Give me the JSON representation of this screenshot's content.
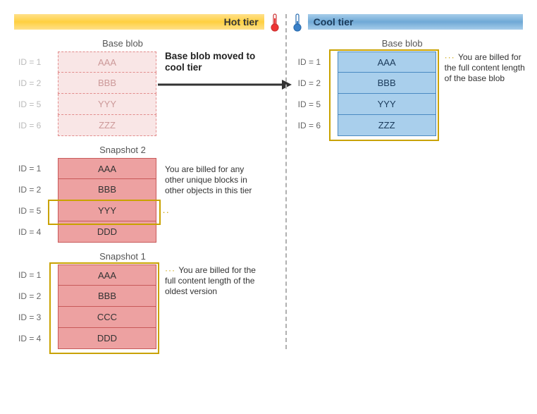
{
  "hot": {
    "label": "Hot tier",
    "base": {
      "title": "Base blob",
      "rows": [
        {
          "id": "ID = 1",
          "val": "AAA"
        },
        {
          "id": "ID = 2",
          "val": "BBB"
        },
        {
          "id": "ID = 5",
          "val": "YYY"
        },
        {
          "id": "ID = 6",
          "val": "ZZZ"
        }
      ]
    },
    "snap2": {
      "title": "Snapshot 2",
      "rows": [
        {
          "id": "ID = 1",
          "val": "AAA"
        },
        {
          "id": "ID = 2",
          "val": "BBB"
        },
        {
          "id": "ID = 5",
          "val": "YYY"
        },
        {
          "id": "ID = 4",
          "val": "DDD"
        }
      ],
      "note": "You are billed for any other unique blocks in other objects in this tier"
    },
    "snap1": {
      "title": "Snapshot 1",
      "rows": [
        {
          "id": "ID = 1",
          "val": "AAA"
        },
        {
          "id": "ID = 2",
          "val": "BBB"
        },
        {
          "id": "ID = 3",
          "val": "CCC"
        },
        {
          "id": "ID = 4",
          "val": "DDD"
        }
      ],
      "note": "You are billed for the full content length of the oldest version"
    },
    "arrow_label": "Base blob moved to cool tier"
  },
  "cool": {
    "label": "Cool tier",
    "base": {
      "title": "Base blob",
      "rows": [
        {
          "id": "ID = 1",
          "val": "AAA"
        },
        {
          "id": "ID = 2",
          "val": "BBB"
        },
        {
          "id": "ID = 5",
          "val": "YYY"
        },
        {
          "id": "ID = 6",
          "val": "ZZZ"
        }
      ],
      "note": "You are billed for the full content length of the base blob"
    }
  }
}
